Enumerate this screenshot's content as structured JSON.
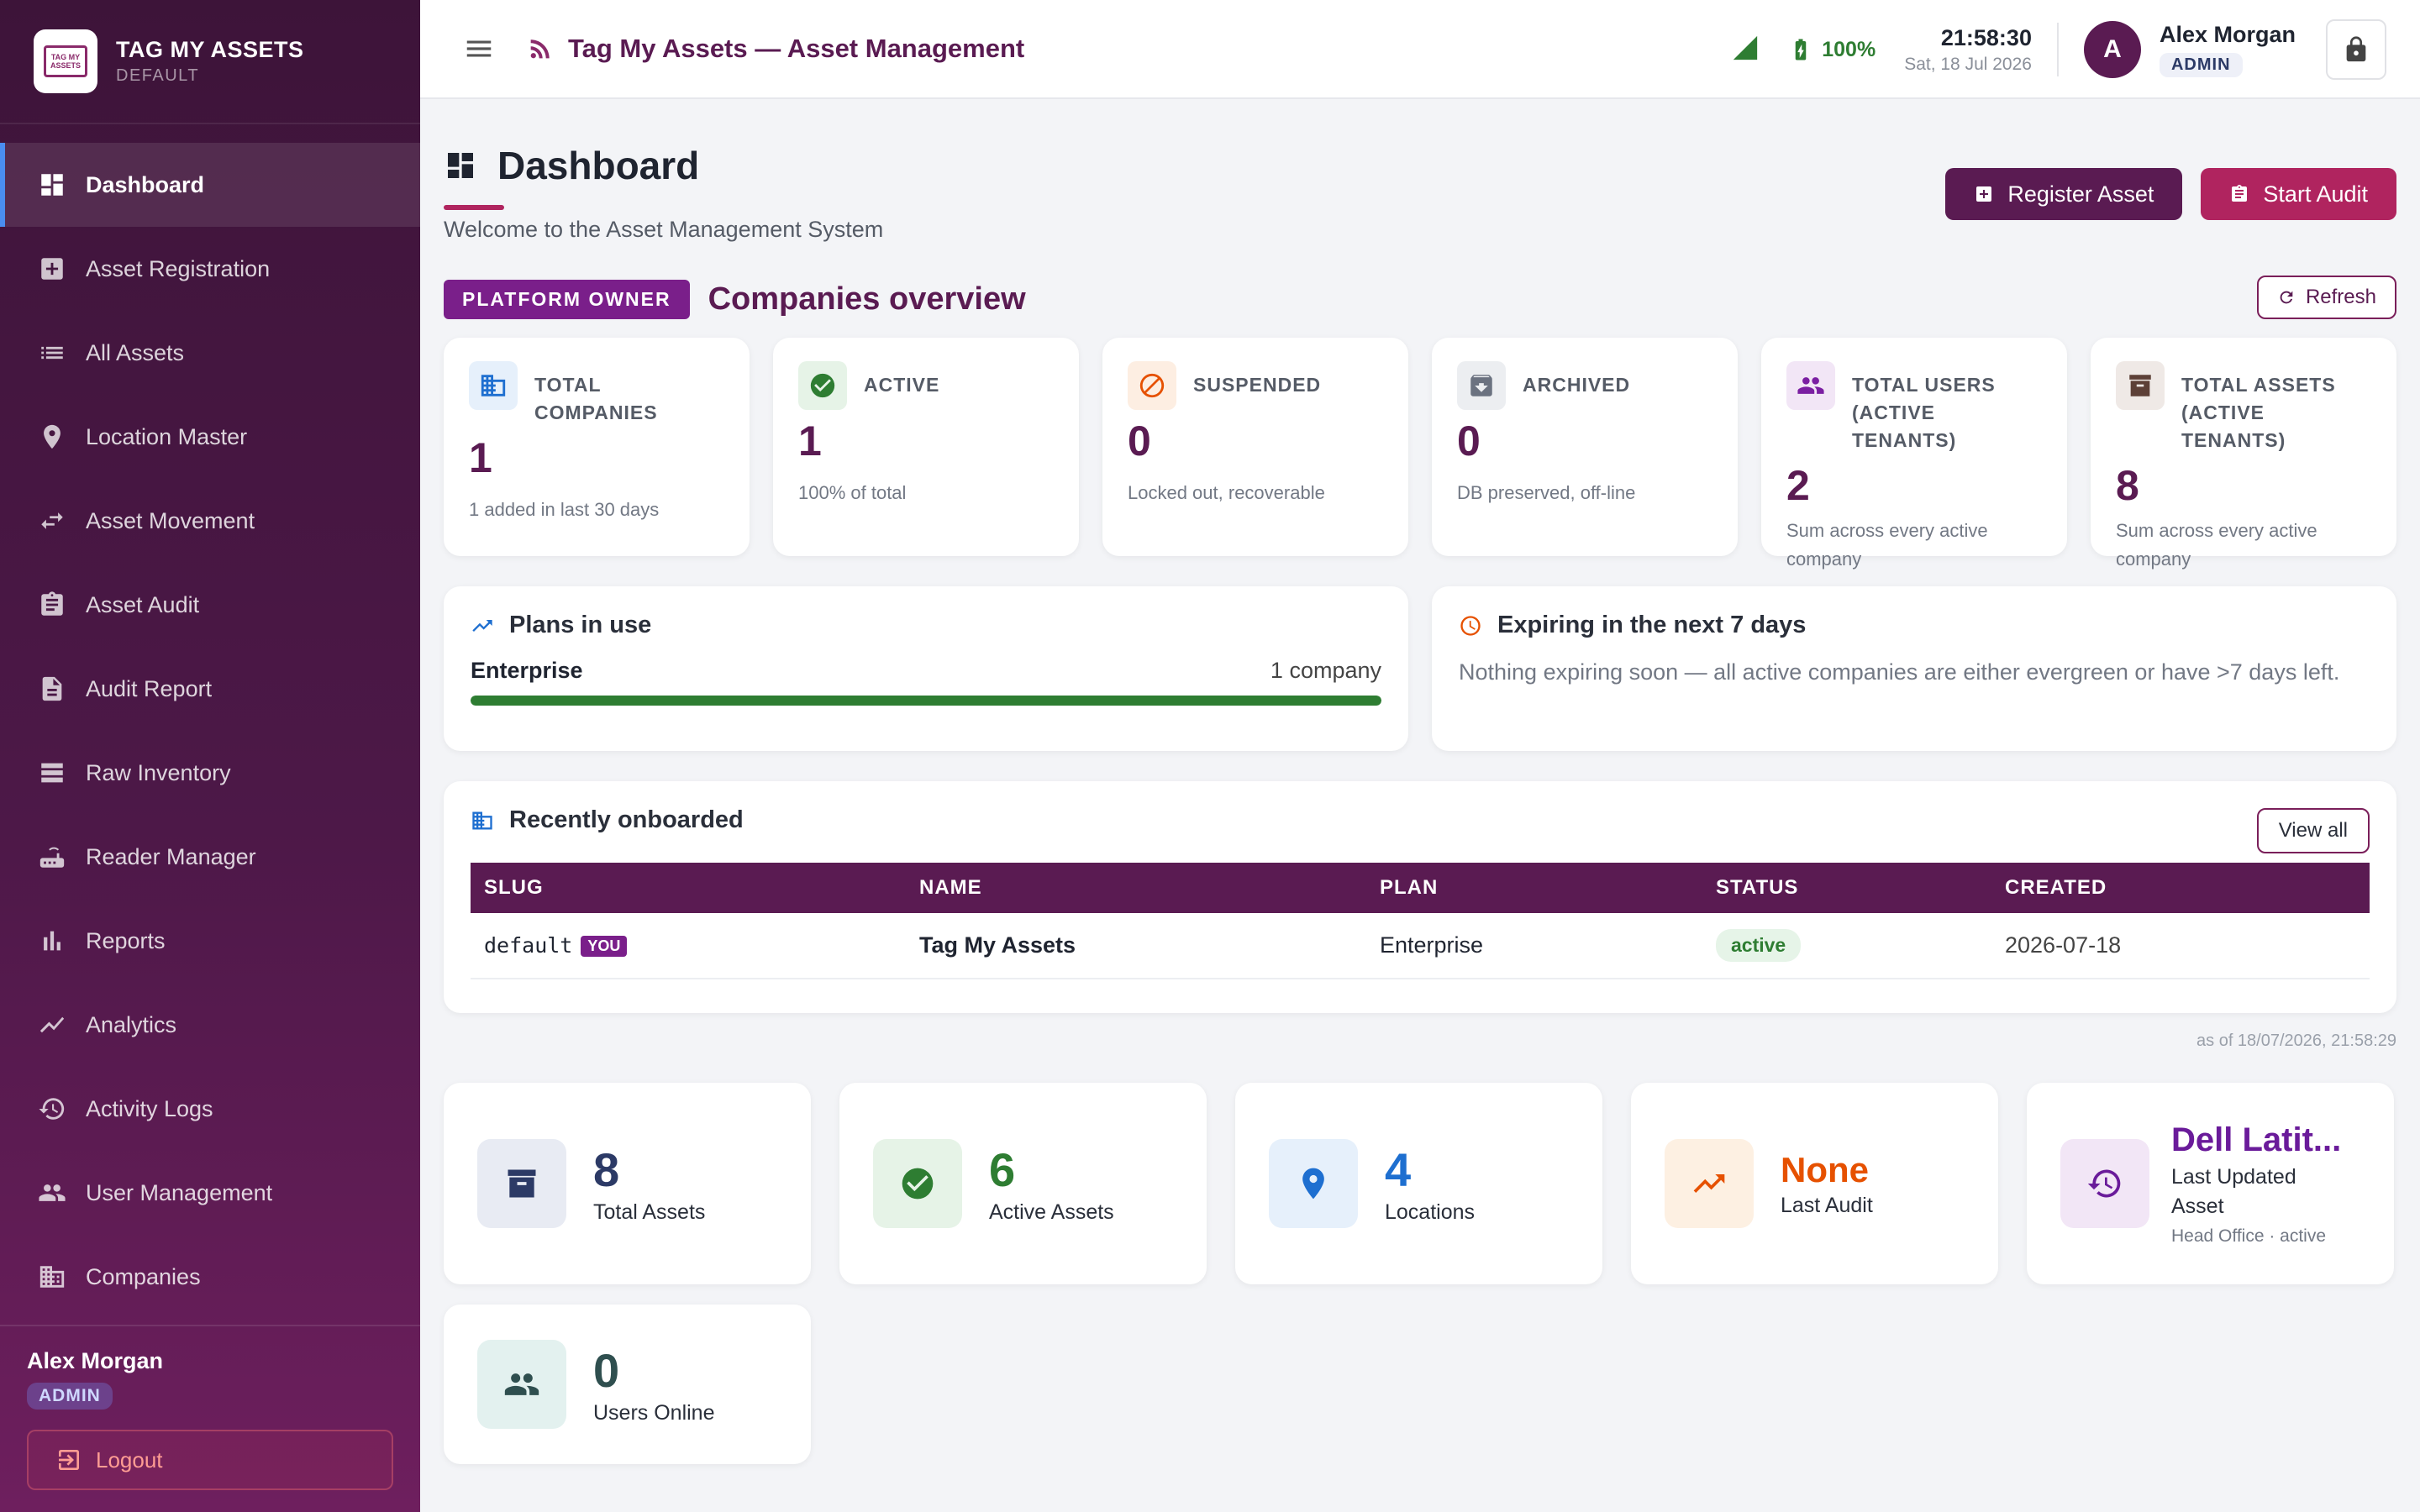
{
  "brand": {
    "title": "TAG MY ASSETS",
    "subtitle": "DEFAULT",
    "logo_text": "TAG MY ASSETS"
  },
  "sidebar": {
    "items": [
      {
        "label": "Dashboard",
        "icon": "dashboard-icon",
        "active": true
      },
      {
        "label": "Asset Registration",
        "icon": "add-box-icon"
      },
      {
        "label": "All Assets",
        "icon": "list-icon"
      },
      {
        "label": "Location Master",
        "icon": "location-pin-icon"
      },
      {
        "label": "Asset Movement",
        "icon": "swap-arrows-icon"
      },
      {
        "label": "Asset Audit",
        "icon": "clipboard-icon"
      },
      {
        "label": "Audit Report",
        "icon": "document-icon"
      },
      {
        "label": "Raw Inventory",
        "icon": "stack-icon"
      },
      {
        "label": "Reader Manager",
        "icon": "router-icon"
      },
      {
        "label": "Reports",
        "icon": "bar-chart-icon"
      },
      {
        "label": "Analytics",
        "icon": "trend-line-icon"
      },
      {
        "label": "Activity Logs",
        "icon": "history-icon"
      },
      {
        "label": "User Management",
        "icon": "people-icon"
      },
      {
        "label": "Companies",
        "icon": "building-icon"
      }
    ],
    "footer": {
      "user": "Alex Morgan",
      "role": "ADMIN",
      "logout_label": "Logout"
    }
  },
  "topbar": {
    "title": "Tag My Assets — Asset Management",
    "battery": "100%",
    "time": "21:58:30",
    "date": "Sat, 18 Jul 2026",
    "avatar_letter": "A",
    "user_name": "Alex Morgan",
    "user_role": "ADMIN"
  },
  "page": {
    "title": "Dashboard",
    "welcome": "Welcome to the Asset Management System",
    "register_label": "Register Asset",
    "audit_label": "Start Audit"
  },
  "overview": {
    "badge": "PLATFORM OWNER",
    "title": "Companies overview",
    "refresh_label": "Refresh",
    "stats": [
      {
        "label": "TOTAL COMPANIES",
        "value": "1",
        "note": "1 added in last 30 days",
        "icon": "building-icon",
        "color": "#1e6fd0",
        "bg": "#e6f0fb"
      },
      {
        "label": "ACTIVE",
        "value": "1",
        "note": "100% of total",
        "icon": "check-circle-icon",
        "color": "#2e7d32",
        "bg": "#e6f3e7"
      },
      {
        "label": "SUSPENDED",
        "value": "0",
        "note": "Locked out, recoverable",
        "icon": "block-icon",
        "color": "#e65100",
        "bg": "#fdeee2"
      },
      {
        "label": "ARCHIVED",
        "value": "0",
        "note": "DB preserved, off-line",
        "icon": "archive-icon",
        "color": "#6b7280",
        "bg": "#eceef1"
      },
      {
        "label": "TOTAL USERS (ACTIVE TENANTS)",
        "value": "2",
        "note": "Sum across every active company",
        "icon": "people-icon",
        "color": "#7b1fa2",
        "bg": "#f2e6f6"
      },
      {
        "label": "TOTAL ASSETS (ACTIVE TENANTS)",
        "value": "8",
        "note": "Sum across every active company",
        "icon": "archive-box-icon",
        "color": "#5d4037",
        "bg": "#efe9e6"
      }
    ]
  },
  "plans": {
    "title": "Plans in use",
    "name": "Enterprise",
    "count": "1 company",
    "fill_fraction": 1.0
  },
  "expiring": {
    "title": "Expiring in the next 7 days",
    "text": "Nothing expiring soon — all active companies are either evergreen or have >7 days left."
  },
  "recent": {
    "title": "Recently onboarded",
    "view_all": "View all",
    "columns": [
      "SLUG",
      "NAME",
      "PLAN",
      "STATUS",
      "CREATED"
    ],
    "rows": [
      {
        "slug": "default",
        "you": "YOU",
        "name": "Tag My Assets",
        "plan": "Enterprise",
        "status": "active",
        "created": "2026-07-18"
      }
    ],
    "as_of": "as of 18/07/2026, 21:58:29"
  },
  "kpis": [
    {
      "value": "8",
      "label": "Total Assets",
      "sub": "",
      "icon": "archive-box-icon",
      "color": "#2c3a66",
      "bg": "#e8ebf3"
    },
    {
      "value": "6",
      "label": "Active Assets",
      "sub": "",
      "icon": "check-circle-icon",
      "color": "#2e7d32",
      "bg": "#e6f3e7"
    },
    {
      "value": "4",
      "label": "Locations",
      "sub": "",
      "icon": "location-pin-icon",
      "color": "#1e6fd0",
      "bg": "#e6f0fb"
    },
    {
      "value": "None",
      "label": "Last Audit",
      "sub": "",
      "icon": "trend-up-icon",
      "color": "#e65100",
      "bg": "#fdf0e2"
    },
    {
      "value": "Dell Latit...",
      "label": "Last Updated Asset",
      "sub": "Head Office · active",
      "icon": "history-icon",
      "color": "#6a1b9a",
      "bg": "#f2e6f6"
    },
    {
      "value": "0",
      "label": "Users Online",
      "sub": "",
      "icon": "people-icon",
      "color": "#2f4f4f",
      "bg": "#e3f1ef"
    }
  ]
}
